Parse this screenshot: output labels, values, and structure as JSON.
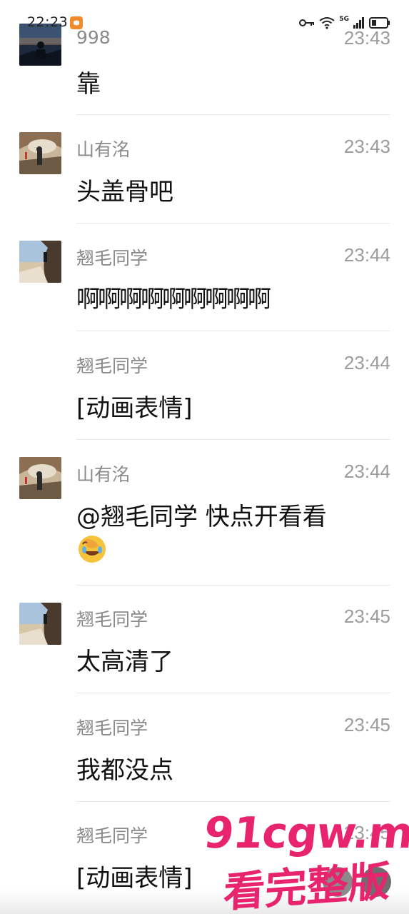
{
  "status_bar": {
    "time": "22:23",
    "network": "5G"
  },
  "messages": [
    {
      "sender": "998",
      "time": "23:43",
      "text": "靠",
      "avatar": "night-hiker-avatar"
    },
    {
      "sender": "山有洺",
      "time": "23:43",
      "text": "头盖骨吧",
      "avatar": "cave-hiker-avatar"
    },
    {
      "sender": "翘毛同学",
      "time": "23:44",
      "text": "啊啊啊啊啊啊啊啊啊",
      "avatar": "cliff-avatar"
    },
    {
      "sender": "翘毛同学",
      "time": "23:44",
      "text": "[动画表情]",
      "avatar": ""
    },
    {
      "sender": "山有洺",
      "time": "23:44",
      "text": "@翘毛同学 快点开看看",
      "emoji": "facepalm-laughing-emoji",
      "avatar": "cave-hiker-avatar"
    },
    {
      "sender": "翘毛同学",
      "time": "23:45",
      "text": "太高清了",
      "avatar": "cliff-avatar"
    },
    {
      "sender": "翘毛同学",
      "time": "23:45",
      "text": "我都没点",
      "avatar": ""
    },
    {
      "sender": "翘毛同学",
      "time": "23:45",
      "text": "[动画表情]",
      "avatar": ""
    }
  ],
  "watermark": {
    "line1": "91cgw.me",
    "line2": "看完整版"
  },
  "colors": {
    "watermark": "#e8246e",
    "sender": "#8a8a8a",
    "time": "#9b9b9b"
  }
}
